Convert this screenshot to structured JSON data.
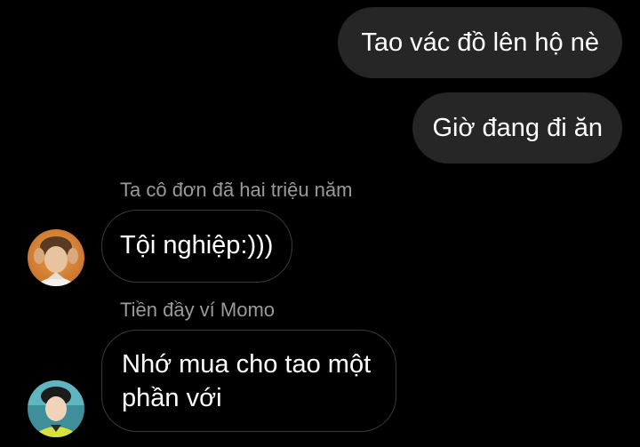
{
  "outgoing": [
    {
      "text": "Tao vác đồ lên hộ nè"
    },
    {
      "text": "Giờ đang đi ăn"
    }
  ],
  "incoming": [
    {
      "sender": "Ta cô đơn đã hai triệu năm",
      "text": "Tội nghiệp:)))"
    },
    {
      "sender": "Tiền đầy ví Momo",
      "text": "Nhớ mua cho tao một phần với"
    }
  ],
  "colors": {
    "background": "#000000",
    "outgoing_bubble": "#262626",
    "incoming_border": "#3a3a3a",
    "sender_name": "#9a9a9a"
  }
}
